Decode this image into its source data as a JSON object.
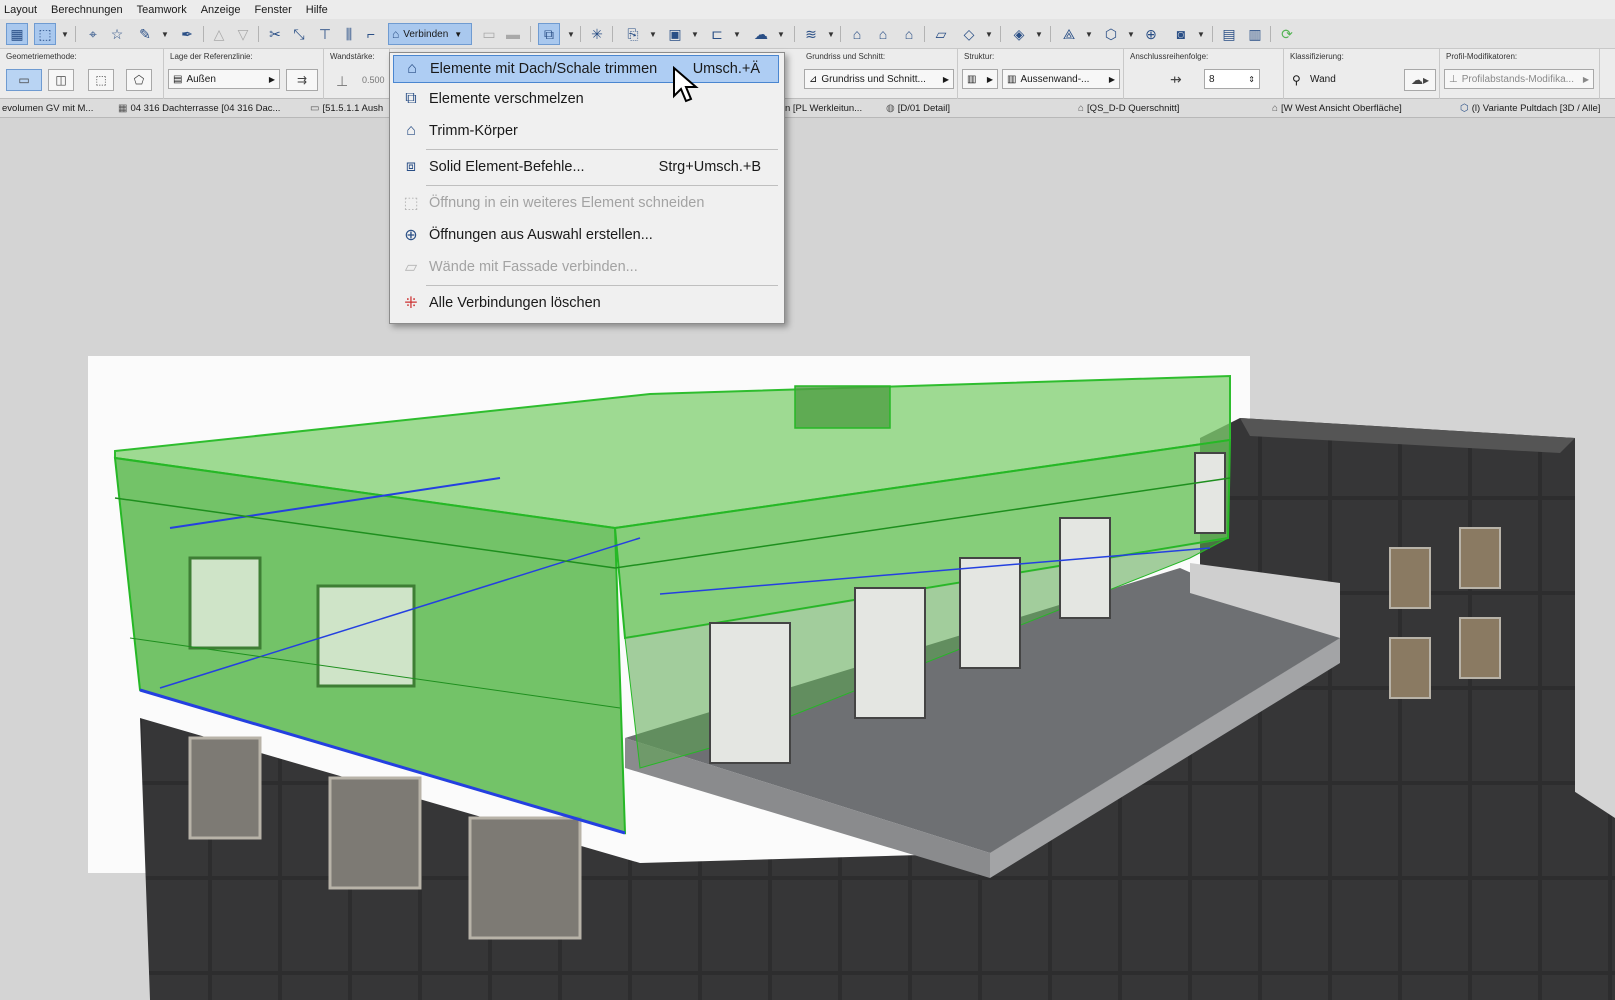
{
  "menubar": {
    "items": [
      "Layout",
      "Berechnungen",
      "Teamwork",
      "Anzeige",
      "Fenster",
      "Hilfe"
    ]
  },
  "toolbar": {
    "verbinden_label": "Verbinden"
  },
  "infobox": {
    "geometriemethode_label": "Geometriemethode:",
    "referenzlinie_label": "Lage der Referenzlinie:",
    "referenzlinie_value": "Außen",
    "wandstaerke_label": "Wandstärke:",
    "wandstaerke_value": "0.500",
    "grundriss_label": "Grundriss und Schnitt:",
    "grundriss_value": "Grundriss und Schnitt...",
    "struktur_label": "Struktur:",
    "struktur_value": "Aussenwand-...",
    "anschluss_label": "Anschlussreihenfolge:",
    "anschluss_value": "8",
    "klassifizierung_label": "Klassifizierung:",
    "klassifizierung_value": "Wand",
    "profil_label": "Profil-Modifikatoren:",
    "profil_value": "Profilabstands-Modifika..."
  },
  "tabs": [
    "evolumen GV mit M...",
    "04 316 Dachterrasse [04 316 Dac...",
    "[51.5.1.1 Aush",
    "n [PL Werkleitun...",
    "[D/01 Detail]",
    "[QS_D-D Querschnitt]",
    "[W West Ansicht Oberfläche]",
    "(l) Variante Pultdach [3D / Alle]"
  ],
  "context_menu": {
    "items": [
      {
        "label": "Elemente mit Dach/Schale trimmen",
        "shortcut": "Umsch.+Ä",
        "icon": "trim-roof-icon",
        "state": "highlighted"
      },
      {
        "label": "Elemente verschmelzen",
        "shortcut": "",
        "icon": "merge-icon",
        "state": "enabled"
      },
      {
        "label": "Trimm-Körper",
        "shortcut": "",
        "icon": "trim-body-icon",
        "state": "enabled"
      },
      {
        "label": "Solid Element-Befehle...",
        "shortcut": "Strg+Umsch.+B",
        "icon": "solid-element-icon",
        "state": "enabled"
      },
      {
        "label": "Öffnung in ein weiteres Element schneiden",
        "shortcut": "",
        "icon": "cut-opening-icon",
        "state": "disabled"
      },
      {
        "label": "Öffnungen aus Auswahl erstellen...",
        "shortcut": "",
        "icon": "create-openings-icon",
        "state": "enabled"
      },
      {
        "label": "Wände mit Fassade verbinden...",
        "shortcut": "",
        "icon": "connect-facade-icon",
        "state": "disabled"
      },
      {
        "label": "Alle Verbindungen löschen",
        "shortcut": "",
        "icon": "delete-connections-icon",
        "state": "enabled"
      }
    ]
  },
  "colors": {
    "selection_green": "#3fd13f",
    "highlight_blue": "#aecdf3",
    "building_dark": "#2f2f30",
    "roof_grey": "#6e7073"
  }
}
